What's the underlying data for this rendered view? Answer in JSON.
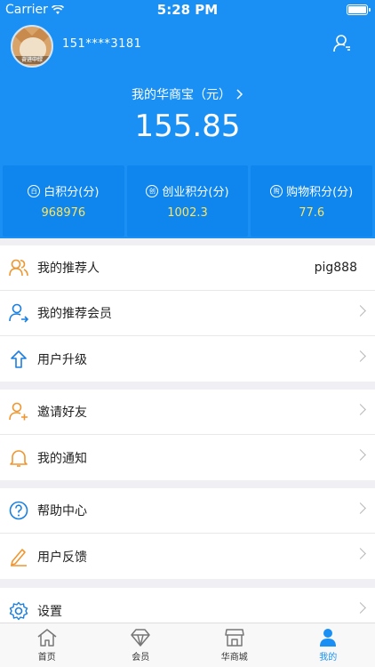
{
  "status_bar": {
    "carrier": "Carrier",
    "time": "5:28 PM"
  },
  "profile": {
    "avatar_caption": "奋进中绿",
    "phone": "151****3181"
  },
  "wallet": {
    "label": "我的华商宝（元）",
    "balance": "155.85"
  },
  "points": [
    {
      "icon": "白",
      "label": "白积分(分)",
      "value": "968976"
    },
    {
      "icon": "创",
      "label": "创业积分(分)",
      "value": "1002.3"
    },
    {
      "icon": "购",
      "label": "购物积分(分)",
      "value": "77.6"
    }
  ],
  "menu": {
    "referrer": {
      "label": "我的推荐人",
      "value": "pig888"
    },
    "referred_members": {
      "label": "我的推荐会员"
    },
    "upgrade": {
      "label": "用户升级"
    },
    "invite": {
      "label": "邀请好友"
    },
    "notifications": {
      "label": "我的通知"
    },
    "help": {
      "label": "帮助中心"
    },
    "feedback": {
      "label": "用户反馈"
    },
    "settings": {
      "label": "设置"
    }
  },
  "tabs": [
    {
      "label": "首页"
    },
    {
      "label": "会员"
    },
    {
      "label": "华商城"
    },
    {
      "label": "我的"
    }
  ],
  "colors": {
    "primary": "#1a90f5",
    "points_value": "#ffe45c",
    "orange_icon": "#f0962e",
    "blue_icon": "#1a7fe0"
  }
}
